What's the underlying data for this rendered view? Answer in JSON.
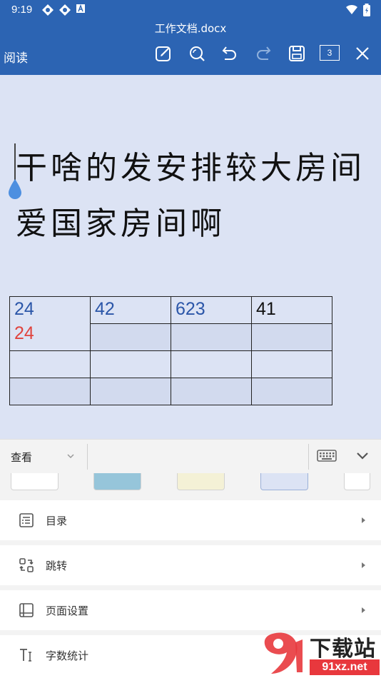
{
  "status_bar": {
    "time": "9:19"
  },
  "header": {
    "title": "工作文档.docx",
    "mode_label": "阅读",
    "page_count": "3",
    "icons": [
      "edit-icon",
      "search-icon",
      "undo-icon",
      "redo-icon",
      "save-icon",
      "close-icon"
    ]
  },
  "document": {
    "paragraph": "干啥的发安排较大房间爱国家房间啊",
    "table": {
      "rows": [
        [
          {
            "lines": [
              "24",
              "24"
            ],
            "colors": [
              "#2b56a8",
              "#e0443e"
            ]
          },
          {
            "lines": [
              "42"
            ],
            "colors": [
              "#2b56a8"
            ]
          },
          {
            "lines": [
              "623"
            ],
            "colors": [
              "#2b56a8"
            ]
          },
          {
            "lines": [
              "41"
            ],
            "colors": [
              "#111111"
            ]
          }
        ]
      ]
    }
  },
  "bottom_panel": {
    "current_tab": "查看",
    "menu_items": [
      {
        "label": "目录",
        "icon": "toc-icon"
      },
      {
        "label": "跳转",
        "icon": "jump-icon"
      },
      {
        "label": "页面设置",
        "icon": "page-setup-icon"
      },
      {
        "label": "字数统计",
        "icon": "word-count-icon"
      }
    ],
    "swatches": [
      "#ffffff",
      "#96c5da",
      "#f4f1d6",
      "#dce3f4",
      "#ffffff"
    ]
  },
  "colors": {
    "header_bg": "#2c64b3",
    "canvas_bg": "#dce3f4"
  },
  "watermark": {
    "text": "下载站",
    "domain": "91xz.net"
  }
}
